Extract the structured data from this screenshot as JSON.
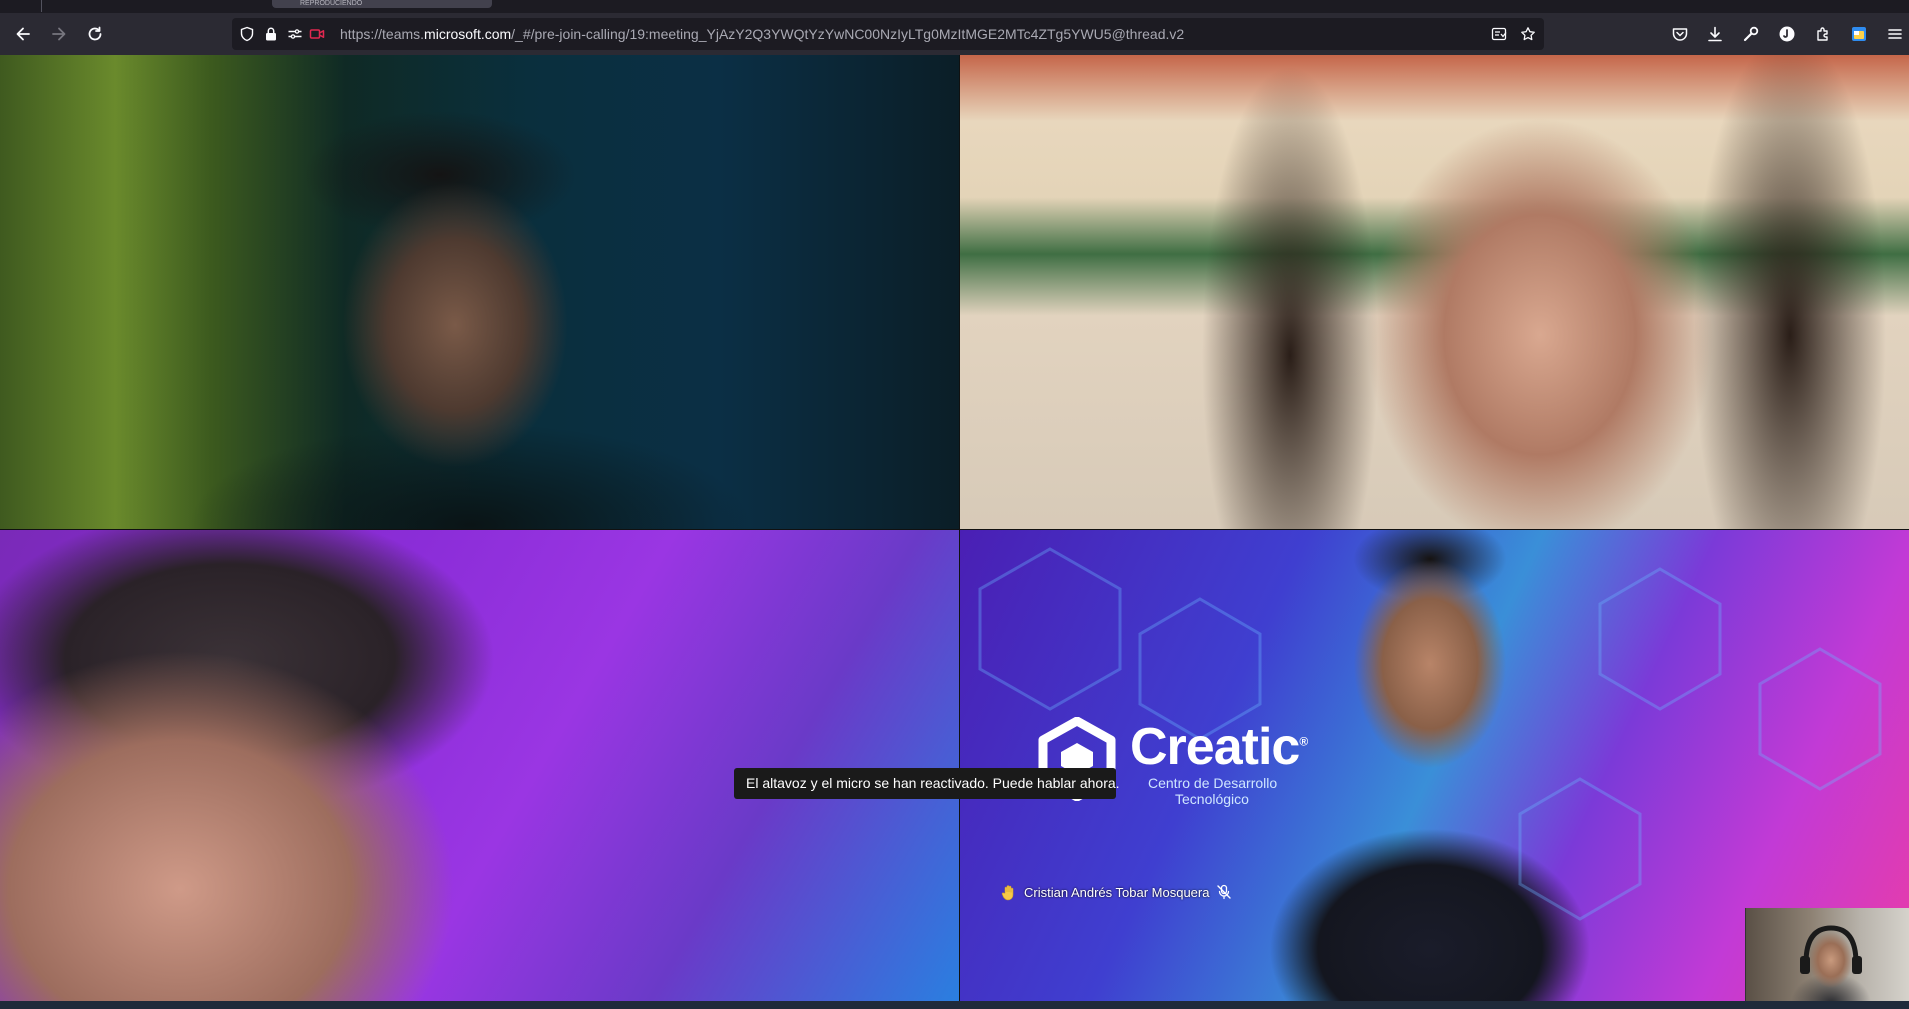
{
  "browser": {
    "tab_label": "REPRODUCIENDO",
    "url_prefix": "https://teams.",
    "url_domain": "microsoft.com",
    "url_rest": "/_#/pre-join-calling/19:meeting_YjAzY2Q3YWQtYzYwNC00NzIyLTg0MzItMGE2MTc4ZTg5YWU5@thread.v2"
  },
  "toolbar_icons": [
    "pocket-icon",
    "downloads-icon",
    "wrench-icon",
    "profile-icon",
    "extensions-icon",
    "calendar-extension-icon",
    "menu-icon"
  ],
  "meeting": {
    "toast_message": "El altavoz y el micro se han reactivado. Puede hablar ahora.",
    "participant_name": "Cristian Andrés Tobar Mosquera",
    "logo_word": "Creatic",
    "logo_registered": "®",
    "logo_sub_line1": "Centro de Desarrollo",
    "logo_sub_line2": "Tecnológico"
  }
}
